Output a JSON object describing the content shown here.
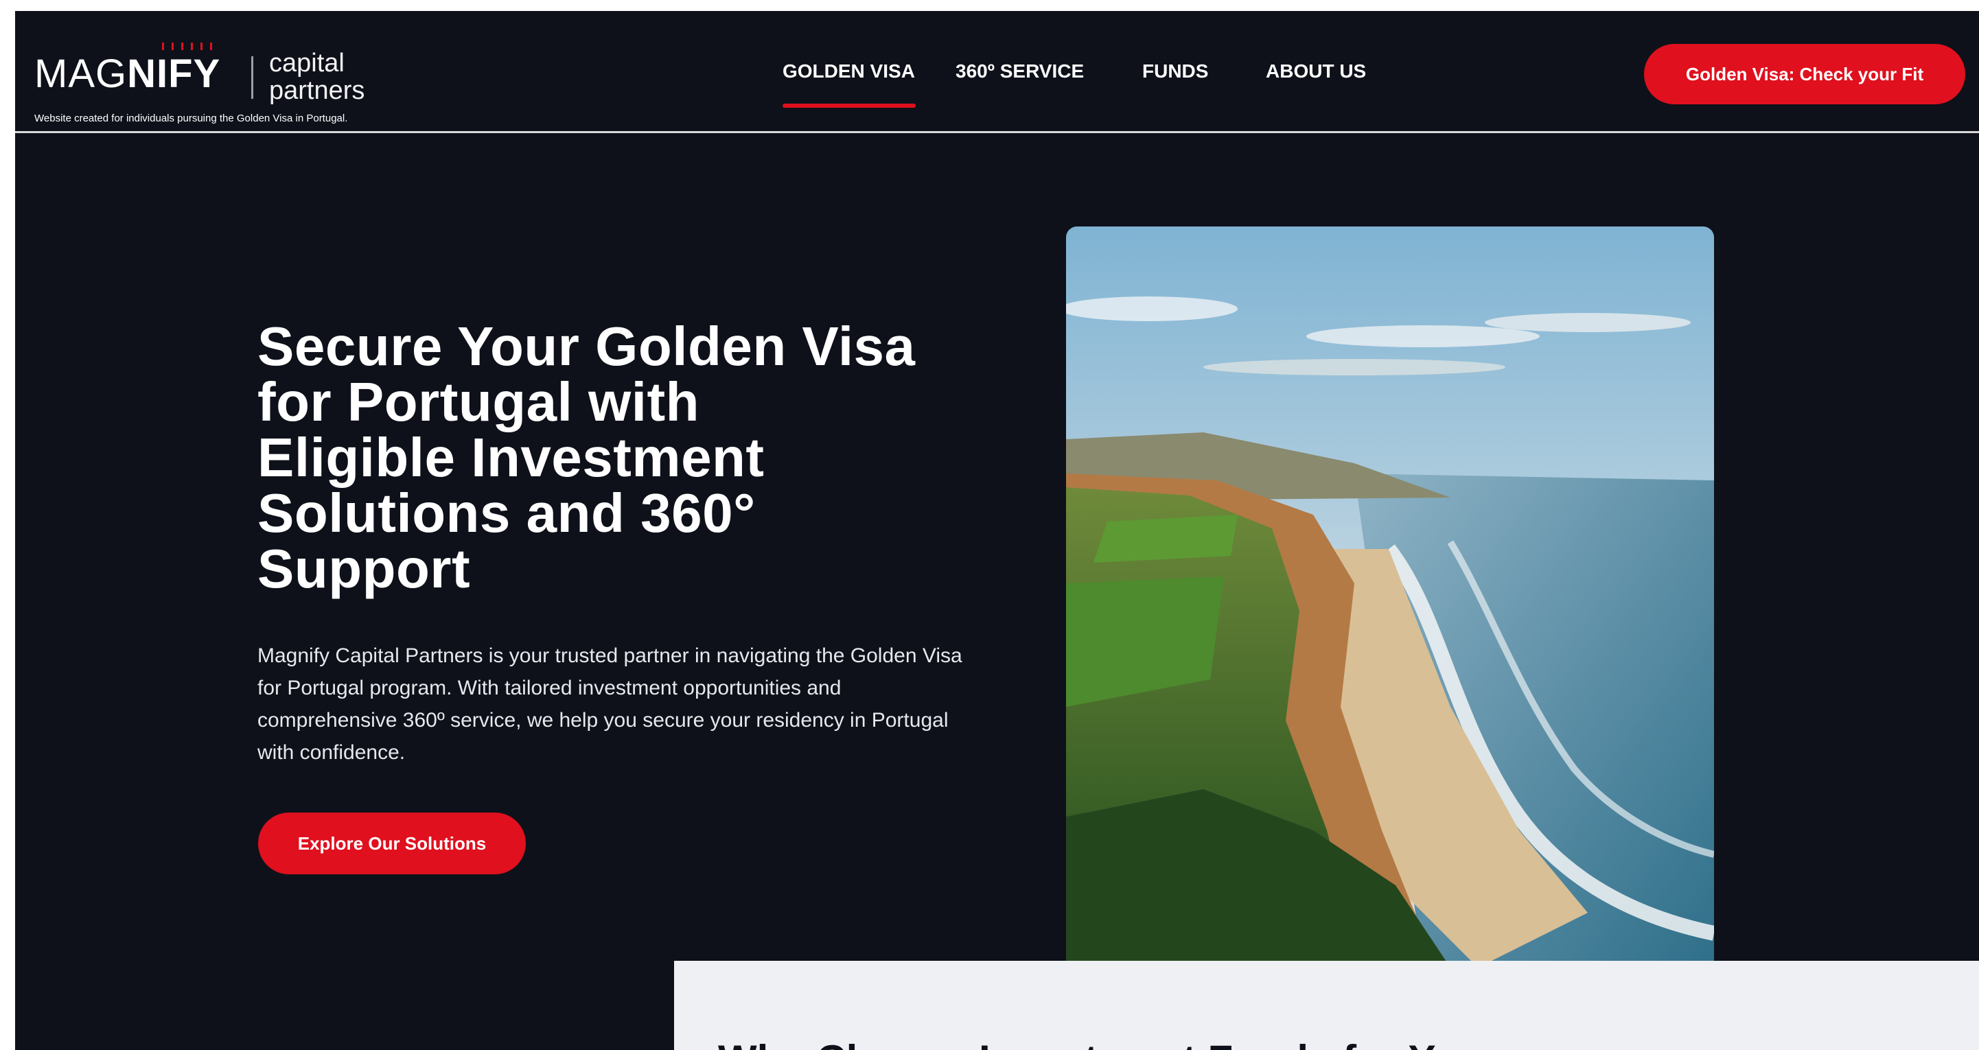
{
  "header": {
    "logo": {
      "brand_light": "MAG",
      "brand_bold": "NIFY",
      "sub_line1": "capital",
      "sub_line2": "partners",
      "tagline": "Website created for individuals pursuing the Golden Visa in Portugal."
    },
    "nav": {
      "items": [
        {
          "label": "GOLDEN VISA",
          "active": true
        },
        {
          "label": "360º SERVICE"
        },
        {
          "label": "FUNDS"
        },
        {
          "label": "ABOUT US"
        }
      ]
    },
    "cta_label": "Golden Visa: Check your Fit"
  },
  "hero": {
    "title_lines": [
      "Secure Your Golden Visa",
      "for Portugal with",
      "Eligible Investment",
      "Solutions and 360°",
      "Support"
    ],
    "description": "Magnify Capital Partners is your trusted partner in navigating the Golden Visa for Portugal program. With tailored investment opportunities and comprehensive 360º service, we help you secure your residency in Portugal with confidence.",
    "cta_label": "Explore Our Solutions",
    "image": "coastal-cliffs-photo"
  },
  "next_section": {
    "heading": "Why Choose Investment Funds for Your"
  },
  "colors": {
    "background": "#0e111a",
    "accent": "#e0101e",
    "panel": "#eef0f3",
    "text": "#ffffff"
  }
}
